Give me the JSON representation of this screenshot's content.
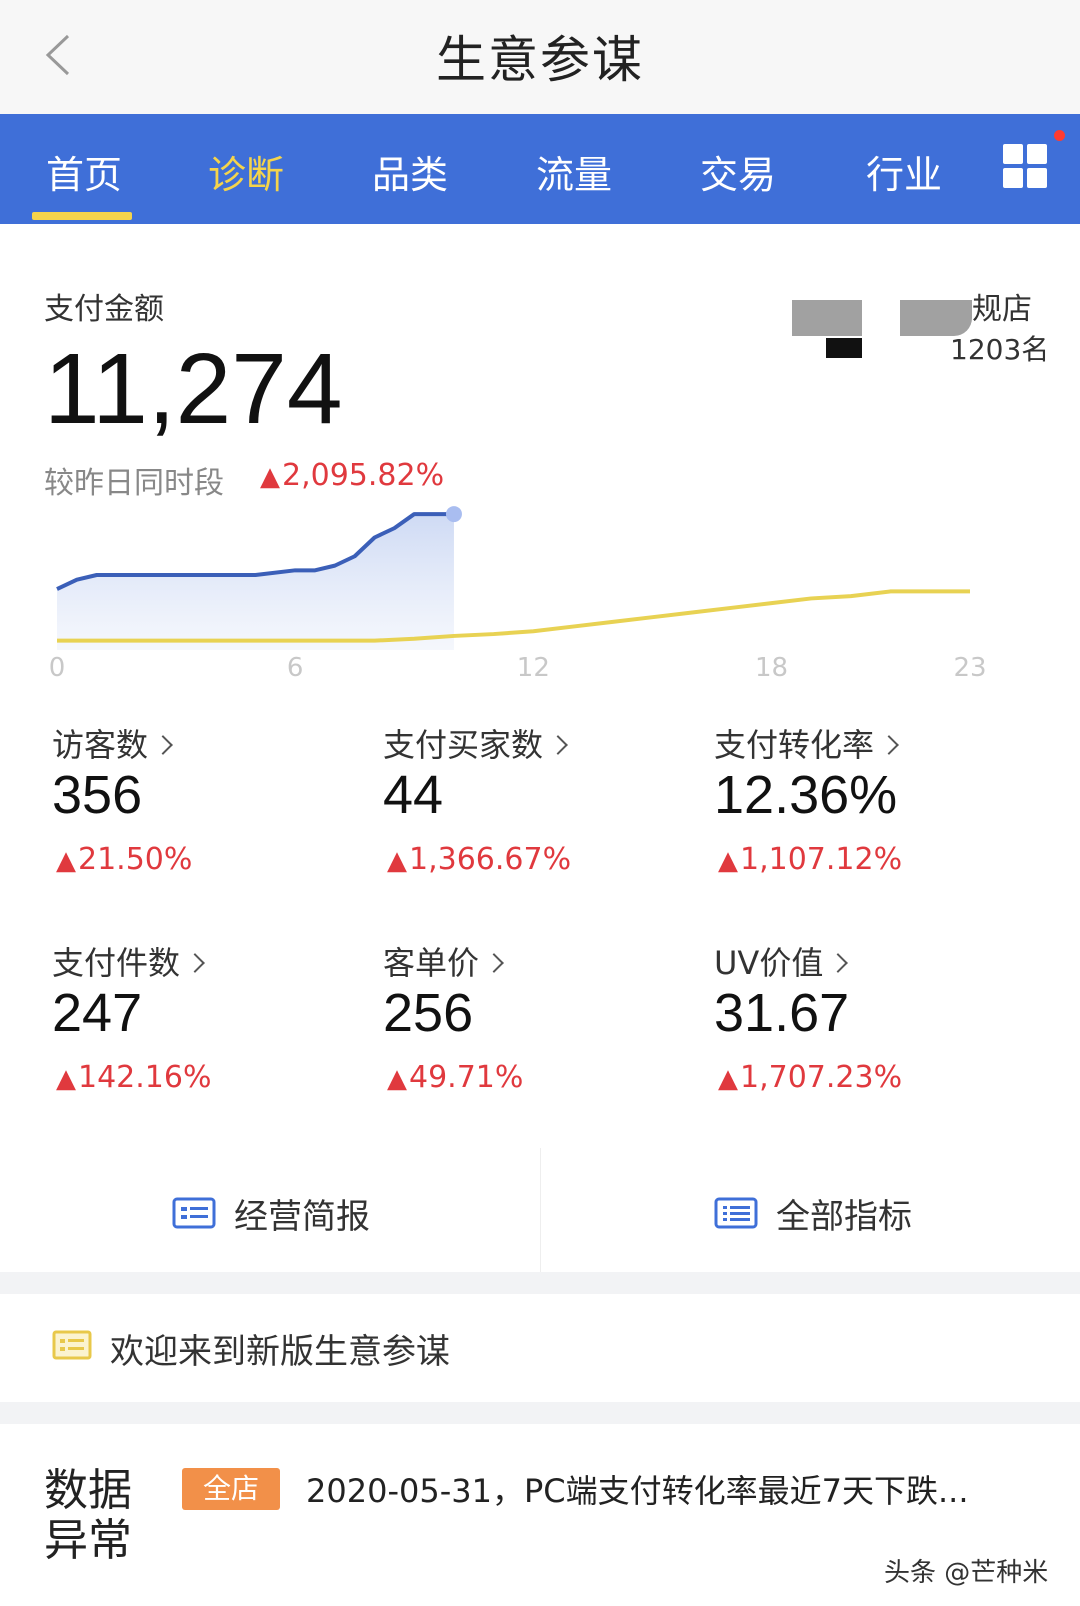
{
  "header": {
    "title": "生意参谋"
  },
  "tabs": [
    {
      "label": "首页",
      "color": "white"
    },
    {
      "label": "诊断",
      "color": "yellow"
    },
    {
      "label": "品类",
      "color": "white"
    },
    {
      "label": "流量",
      "color": "white"
    },
    {
      "label": "交易",
      "color": "white"
    },
    {
      "label": "行业",
      "color": "white"
    }
  ],
  "summary": {
    "label": "支付金额",
    "amount": "11,274",
    "compare_label": "较昨日同时段",
    "compare_value": "2,095.82%",
    "store_suffix": "规店",
    "rank": "1203名"
  },
  "chart_data": {
    "type": "line",
    "x_ticks": [
      "0",
      "6",
      "12",
      "18",
      "23"
    ],
    "series": [
      {
        "color": "#3b5fb8",
        "x": [
          0,
          0.5,
          1,
          2,
          3,
          4,
          5,
          6,
          6.5,
          7,
          7.5,
          8,
          8.5,
          9,
          10
        ],
        "y": [
          13,
          15,
          16,
          16,
          16,
          16,
          16,
          17,
          17,
          18,
          20,
          24,
          26,
          29,
          29
        ]
      },
      {
        "color": "#e8d253",
        "x": [
          0,
          2,
          4,
          6,
          8,
          9,
          10,
          11,
          12,
          13,
          14,
          15,
          16,
          17,
          18,
          19,
          20,
          21,
          22,
          23
        ],
        "y": [
          2,
          2,
          2,
          2,
          2,
          2.4,
          3,
          3.4,
          4,
          5,
          6,
          7,
          8,
          9,
          10,
          11,
          11.5,
          12.5,
          12.5,
          12.5
        ]
      }
    ],
    "ylim": [
      0,
      32
    ]
  },
  "metrics": [
    {
      "label": "访客数",
      "value": "356",
      "change": "21.50%"
    },
    {
      "label": "支付买家数",
      "value": "44",
      "change": "1,366.67%"
    },
    {
      "label": "支付转化率",
      "value": "12.36%",
      "change": "1,107.12%"
    },
    {
      "label": "支付件数",
      "value": "247",
      "change": "142.16%"
    },
    {
      "label": "客单价",
      "value": "256",
      "change": "49.71%"
    },
    {
      "label": "UV价值",
      "value": "31.67",
      "change": "1,707.23%"
    }
  ],
  "buttons": {
    "report": "经营简报",
    "all_metrics": "全部指标"
  },
  "welcome": {
    "text": "欢迎来到新版生意参谋"
  },
  "anomaly": {
    "title": "数据异常",
    "badge": "全店",
    "text": "2020-05-31，PC端支付转化率最近7天下跌..."
  },
  "watermark": "头条 @芒种米",
  "colors": {
    "primary": "#3f6fd8",
    "accent": "#f5d44b",
    "up": "#e0393e",
    "badge": "#f29049"
  }
}
